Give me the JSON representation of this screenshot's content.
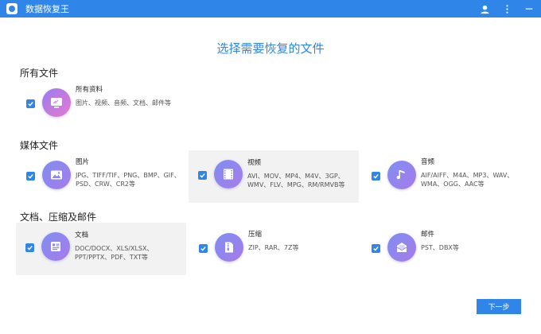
{
  "app": {
    "title": "数据恢复王"
  },
  "main_title": "选择需要恢复的文件",
  "sections": {
    "all": "所有文件",
    "media": "媒体文件",
    "docs": "文档、压缩及邮件"
  },
  "cards": {
    "all_data": {
      "title": "所有资料",
      "desc": "图片、视频、音频、文档、邮件等",
      "checked": true
    },
    "image": {
      "title": "图片",
      "desc": "JPG、TIFF/TIF、PNG、BMP、GIF、PSD、CRW、CR2等",
      "checked": true
    },
    "video": {
      "title": "视频",
      "desc": "AVI、MOV、MP4、M4V、3GP、WMV、FLV、MPG、RM/RMVB等",
      "checked": true
    },
    "audio": {
      "title": "音频",
      "desc": "AIF/AIFF、M4A、MP3、WAV、WMA、OGG、AAC等",
      "checked": true
    },
    "document": {
      "title": "文档",
      "desc": "DOC/DOCX、XLS/XLSX、PPT/PPTX、PDF、TXT等",
      "checked": true
    },
    "archive": {
      "title": "压缩",
      "desc": "ZIP、RAR、7Z等",
      "checked": true
    },
    "mail": {
      "title": "邮件",
      "desc": "PST、DBX等",
      "checked": true
    }
  },
  "buttons": {
    "next": "下一步"
  },
  "icons": {
    "user": "user-icon",
    "menu": "more-vertical-icon",
    "minimize": "minimize-icon",
    "all_data": "monitor-icon",
    "image": "image-icon",
    "video": "film-icon",
    "audio": "music-note-icon",
    "document": "document-icon",
    "archive": "zip-file-icon",
    "mail": "mail-icon"
  },
  "colors": {
    "accent": "#2f86e8",
    "highlight_bg": "#f2f2f2"
  }
}
